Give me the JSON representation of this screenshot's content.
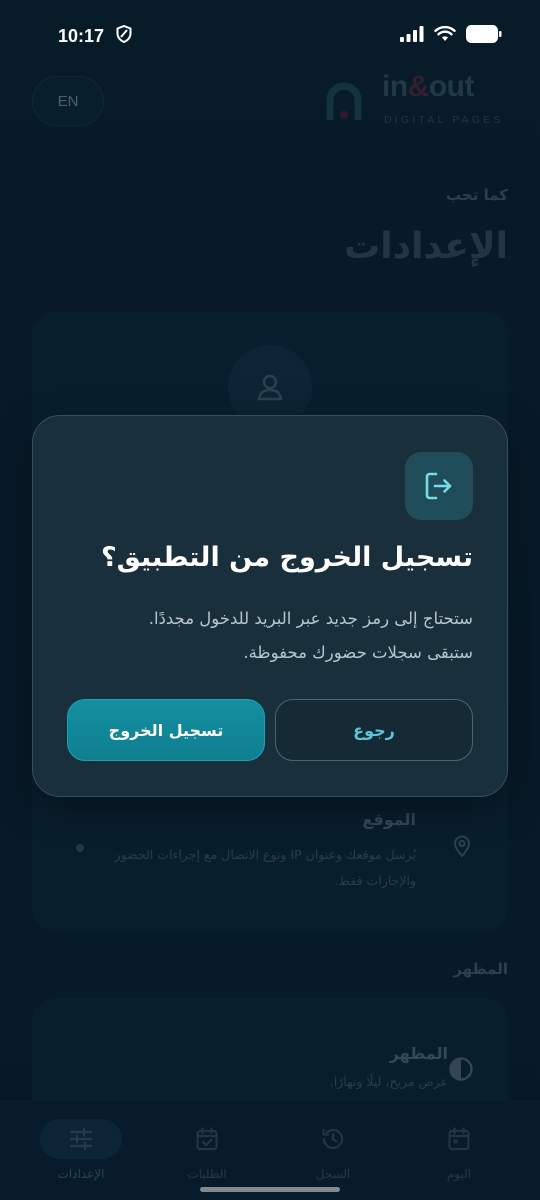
{
  "status_bar": {
    "time": "10:17"
  },
  "header": {
    "lang_button": "EN",
    "logo_word_in": "in",
    "logo_word_amp": "&",
    "logo_word_out": "out",
    "logo_subtitle": "DIGITAL PAGES"
  },
  "page": {
    "subtitle": "كما تحب",
    "title": "الإعدادات"
  },
  "settings": {
    "location_title": "الموقع",
    "location_desc": "يُرسل موقعك وعنوان IP ونوع الاتصال مع إجراءات الحضور والإجازات فقط.",
    "appearance_section": "المظهر",
    "appearance_title": "المظهر",
    "appearance_desc": "عرض مريح، ليلًا ونهارًا."
  },
  "dialog": {
    "title": "تسجيل الخروج من التطبيق؟",
    "message_line1": "ستحتاج إلى رمز جديد عبر البريد للدخول مجددًا.",
    "message_line2": "ستبقى سجلات حضورك محفوظة.",
    "back_button": "رجوع",
    "logout_button": "تسجيل الخروج"
  },
  "bottom_nav": {
    "items": [
      {
        "label": "الإعدادات",
        "icon": "sliders-icon",
        "active": true
      },
      {
        "label": "الطلبات",
        "icon": "calendar-check-icon",
        "active": false
      },
      {
        "label": "السجل",
        "icon": "history-icon",
        "active": false
      },
      {
        "label": "اليوم",
        "icon": "calendar-today-icon",
        "active": false
      }
    ]
  },
  "colors": {
    "background": "#0a2233",
    "dialog_bg": "#1a2f3c",
    "accent": "#138fa0",
    "accent_text": "#5cc6d6"
  }
}
